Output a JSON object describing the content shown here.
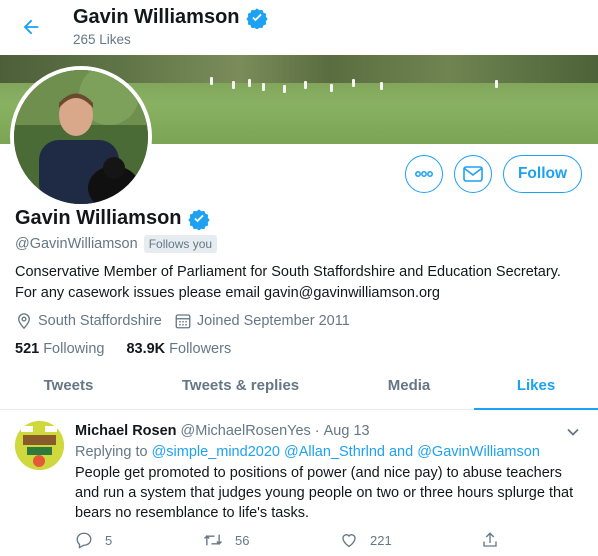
{
  "header": {
    "name": "Gavin Williamson",
    "likes_count": "265 Likes"
  },
  "profile": {
    "name": "Gavin Williamson",
    "handle": "@GavinWilliamson",
    "follows_you": "Follows you",
    "bio": "Conservative Member of Parliament for South Staffordshire and Education Secretary. For any casework issues please email gavin@gavinwilliamson.org",
    "location": "South Staffordshire",
    "joined": "Joined September 2011",
    "following_count": "521",
    "following_label": "Following",
    "followers_count": "83.9K",
    "followers_label": "Followers",
    "follow_button": "Follow"
  },
  "tabs": [
    {
      "label": "Tweets",
      "active": false
    },
    {
      "label": "Tweets & replies",
      "active": false
    },
    {
      "label": "Media",
      "active": false
    },
    {
      "label": "Likes",
      "active": true
    }
  ],
  "tweet": {
    "author": "Michael Rosen",
    "handle": "@MichaelRosenYes",
    "separator": "·",
    "date": "Aug 13",
    "replying_prefix": "Replying to",
    "replying_to": "@simple_mind2020 @Allan_Sthrlnd and @GavinWilliamson",
    "text": "People get promoted to positions of power (and nice pay) to abuse teachers and run a system that judges young people on two or three hours splurge that bears no resemblance to life's tasks.",
    "replies": "5",
    "retweets": "56",
    "likes": "221"
  },
  "colors": {
    "accent": "#1da1f2",
    "text": "#14171a",
    "secondary": "#657786"
  },
  "icons": [
    "back-arrow-icon",
    "verified-badge-icon",
    "more-icon",
    "message-icon",
    "location-icon",
    "calendar-icon",
    "chevron-down-icon",
    "reply-icon",
    "retweet-icon",
    "like-icon",
    "share-icon"
  ]
}
